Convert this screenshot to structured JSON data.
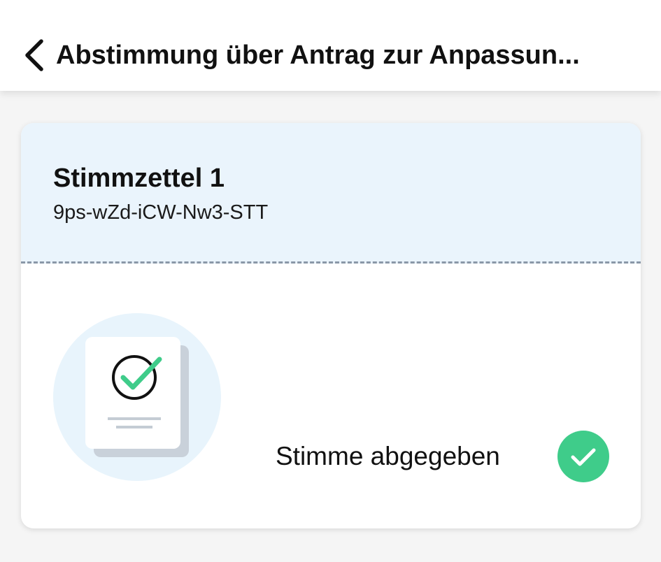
{
  "header": {
    "title": "Abstimmung über Antrag zur Anpassun...",
    "back_icon": "chevron-left-icon"
  },
  "ballot": {
    "title": "Stimmzettel 1",
    "code": "9ps-wZd-iCW-Nw3-STT",
    "status": "Stimme abgegeben",
    "status_icon": "check-circle-icon",
    "illustration_icon": "ballot-document-check-icon"
  },
  "colors": {
    "card_header_bg": "#eaf4fc",
    "accent_green": "#3fcc8a",
    "illustration_circle": "#e8f4fc"
  }
}
